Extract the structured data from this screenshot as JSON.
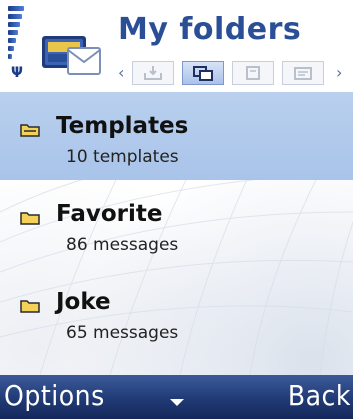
{
  "header": {
    "title": "My folders",
    "app_icon": "messaging-folder-icon",
    "tabs": [
      {
        "icon": "inbox-icon",
        "active": false
      },
      {
        "icon": "my-folders-icon",
        "active": true
      },
      {
        "icon": "drafts-icon",
        "active": false
      },
      {
        "icon": "sent-icon",
        "active": false
      }
    ]
  },
  "status": {
    "signal_icon": "signal-strength-icon",
    "antenna_icon": "antenna-icon"
  },
  "folders": [
    {
      "name": "Templates",
      "count": "10 templates",
      "selected": true
    },
    {
      "name": "Favorite",
      "count": "86 messages",
      "selected": false
    },
    {
      "name": "Joke",
      "count": "65 messages",
      "selected": false
    }
  ],
  "softkeys": {
    "left": "Options",
    "right": "Back",
    "middle_icon": "menu-indicator-icon"
  },
  "colors": {
    "title": "#2b4f97",
    "selection": "#b9d0ee",
    "softkey_bar": "#203a75",
    "folder_icon": "#f2d25a"
  }
}
